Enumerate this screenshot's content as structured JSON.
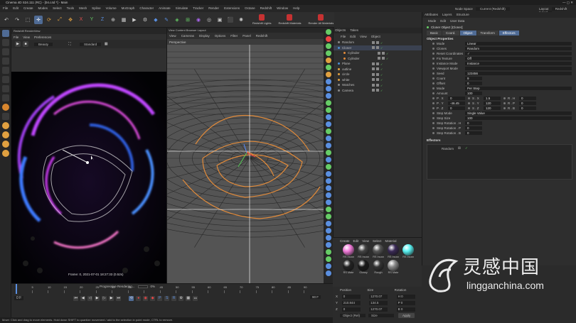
{
  "app": {
    "title": "Cinema 4D S24.111 (RC) - [04.c4d *] - Main",
    "node_space_label": "Node Space",
    "node_space_value": "Current (Redshift)",
    "layout_label": "Layout",
    "layout_value": "Redshift (User)"
  },
  "menu": [
    "File",
    "Edit",
    "Create",
    "Modes",
    "Select",
    "Tools",
    "Mesh",
    "Spline",
    "Volume",
    "MoGraph",
    "Character",
    "Animate",
    "Simulate",
    "Tracker",
    "Render",
    "Extensions",
    "Octane",
    "Redshift",
    "Window",
    "Help"
  ],
  "toolbar": {
    "redshift_buttons": [
      "Redshift Lights",
      "Redshift Materials",
      "Render All Materials"
    ]
  },
  "render_view": {
    "title": "Redshift RenderView",
    "menu": [
      "File",
      "View",
      "Preferences"
    ],
    "beauty": "Beauty",
    "standard": "Standard",
    "status": "Frame: 0,  2021-07-01  18:27:33  (0.52s)",
    "progress_label": "Progressive Rendering...",
    "progress_pct": "0%"
  },
  "viewport": {
    "header": "View   Content Browser  Layout",
    "menu": [
      "View",
      "Cameras",
      "Display",
      "Options",
      "Filter",
      "Panel",
      "Redshift"
    ],
    "label": "Perspective"
  },
  "objects": {
    "tabs": [
      "Objects",
      "Takes"
    ],
    "menu": [
      "File",
      "Edit",
      "View",
      "Object"
    ],
    "rows": [
      {
        "name": "Random",
        "sel": false,
        "tag": "#888"
      },
      {
        "name": "Cloner",
        "sel": true,
        "tag": "#4a8fd4"
      },
      {
        "name": "Cylinder",
        "sel": false,
        "tag": "#e08a3a"
      },
      {
        "name": "Cylinder",
        "sel": false,
        "tag": "#e08a3a"
      },
      {
        "name": "Plane",
        "sel": false,
        "tag": "#4a8fd4"
      },
      {
        "name": "outline",
        "sel": false,
        "tag": "#e0a040"
      },
      {
        "name": "circle",
        "sel": false,
        "tag": "#e0a040"
      },
      {
        "name": "white",
        "sel": false,
        "tag": "#e0a040"
      },
      {
        "name": "Watches",
        "sel": false,
        "tag": "#888"
      },
      {
        "name": "Camera",
        "sel": false,
        "tag": "#888"
      }
    ]
  },
  "materials": {
    "menu": [
      "Create",
      "Edit",
      "View",
      "Select",
      "Material"
    ],
    "items": [
      {
        "name": "RS Incan",
        "color": "#f07ad8"
      },
      {
        "name": "RS Incan",
        "color": "#444"
      },
      {
        "name": "RS Incan",
        "color": "#555"
      },
      {
        "name": "RS Incan",
        "color": "#3a2a55"
      },
      {
        "name": "RS Incan",
        "color": "#58f0f0"
      },
      {
        "name": "RS Mate",
        "color": "#222"
      },
      {
        "name": "Glossy",
        "color": "#1a1a1a"
      },
      {
        "name": "Rough",
        "color": "#333"
      },
      {
        "name": "RS Mate",
        "color": "#888"
      }
    ]
  },
  "coords": {
    "headers": [
      "Position",
      "Size",
      "Rotation"
    ],
    "rows": [
      {
        "axis": "X",
        "pos": "0",
        "size": "1270.07",
        "rot": "H 0"
      },
      {
        "axis": "Y",
        "pos": "210.844",
        "size": "134.5",
        "rot": "P 0"
      },
      {
        "axis": "Z",
        "pos": "0",
        "size": "1270.07",
        "rot": "B 0"
      }
    ],
    "mode": "Object (Rel)",
    "size_mode": "Size",
    "apply": "Apply"
  },
  "attributes": {
    "tabs": [
      "Attributes",
      "Layers",
      "Structure"
    ],
    "menu": [
      "Mode",
      "Edit",
      "User Data"
    ],
    "title": "Cloner Object [Cloner]",
    "subtabs": [
      {
        "label": "Basic",
        "active": false
      },
      {
        "label": "Coord.",
        "active": false
      },
      {
        "label": "Object",
        "active": true
      },
      {
        "label": "Transform",
        "active": false
      },
      {
        "label": "Effectors",
        "active": true
      }
    ],
    "section_title": "Object Properties",
    "props": [
      {
        "label": "Mode",
        "value": "Linear"
      },
      {
        "label": "Clones",
        "value": "Random"
      },
      {
        "label": "Reset Coordinates",
        "value": "✓"
      },
      {
        "label": "Fix Texture",
        "value": "Off"
      },
      {
        "label": "Instance Mode",
        "value": "Instance"
      },
      {
        "label": "Viewport Mode",
        "value": ""
      },
      {
        "label": "Seed",
        "value": "123456"
      },
      {
        "label": "Count",
        "value": "9"
      },
      {
        "label": "Offset",
        "value": "0"
      },
      {
        "label": "Mode",
        "value": "Per Step"
      },
      {
        "label": "Amount",
        "value": "100"
      }
    ],
    "transform_rows": [
      {
        "p": "P . X",
        "pv": "0",
        "s": "S . X",
        "sv": "1.5",
        "r": "R . H",
        "rv": "0"
      },
      {
        "p": "P . Y",
        "pv": "-46.45",
        "s": "S . Y",
        "sv": "120",
        "r": "R . P",
        "rv": "0"
      },
      {
        "p": "P . Z",
        "pv": "0",
        "s": "S . Z",
        "sv": "120",
        "r": "R . B",
        "rv": "0"
      }
    ],
    "step_props": [
      {
        "label": "Step Mode",
        "value": "Single Value"
      },
      {
        "label": "Step Size",
        "value": "100"
      },
      {
        "label": "Step Rotation . H",
        "value": "0"
      },
      {
        "label": "Step Rotation . P",
        "value": "0"
      },
      {
        "label": "Step Rotation . B",
        "value": "0"
      }
    ],
    "effectors_label": "Effectors",
    "effector_item": "Random"
  },
  "timeline": {
    "ticks": [
      "0",
      "5",
      "10",
      "15",
      "20",
      "25",
      "30",
      "35",
      "40",
      "45",
      "50",
      "55",
      "60",
      "65",
      "70",
      "75",
      "80",
      "85",
      "90"
    ],
    "start": "0 F",
    "end": "90 F"
  },
  "status": "Move: Click and drag to move elements. Hold down SHIFT to quantize movement / add to the selection in point mode, CTRL to remove.",
  "watermark": {
    "cn": "灵感中国",
    "url": "lingganchina.com"
  }
}
